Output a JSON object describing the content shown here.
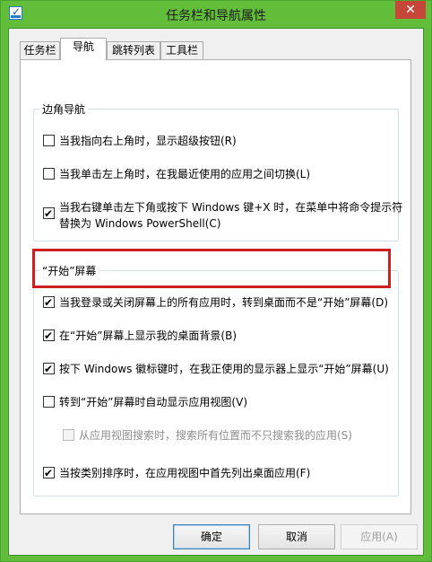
{
  "window": {
    "title": "任务栏和导航属性",
    "close_label": "✕"
  },
  "tabs": [
    "任务栏",
    "导航",
    "跳转列表",
    "工具栏"
  ],
  "active_tab": "导航",
  "group_corner": {
    "label": "边角导航",
    "items": [
      {
        "text": "当我指向右上角时，显示超级按钮(R)",
        "checked": false
      },
      {
        "text": "当我单击左上角时，在我最近使用的应用之间切换(L)",
        "checked": false
      },
      {
        "text": "当我右键单击左下角或按下 Windows 键+X 时，在菜单中将命令提示符替换为 Windows PowerShell(C)",
        "checked": true
      }
    ]
  },
  "group_start": {
    "label": "“开始”屏幕",
    "items": [
      {
        "text": "当我登录或关闭屏幕上的所有应用时，转到桌面而不是“开始”屏幕(D)",
        "checked": true,
        "highlighted": true
      },
      {
        "text": "在“开始”屏幕上显示我的桌面背景(B)",
        "checked": true
      },
      {
        "text": "按下 Windows 徽标键时，在我正使用的显示器上显示“开始”屏幕(U)",
        "checked": true
      },
      {
        "text": "转到“开始”屏幕时自动显示应用视图(V)",
        "checked": false
      },
      {
        "text": "从应用视图搜索时，搜索所有位置而不只搜索我的应用(S)",
        "checked": false,
        "disabled": true
      },
      {
        "text": "当按类别排序时，在应用视图中首先列出桌面应用(F)",
        "checked": true
      }
    ]
  },
  "buttons": {
    "ok": "确定",
    "cancel": "取消",
    "apply": "应用(A)"
  }
}
